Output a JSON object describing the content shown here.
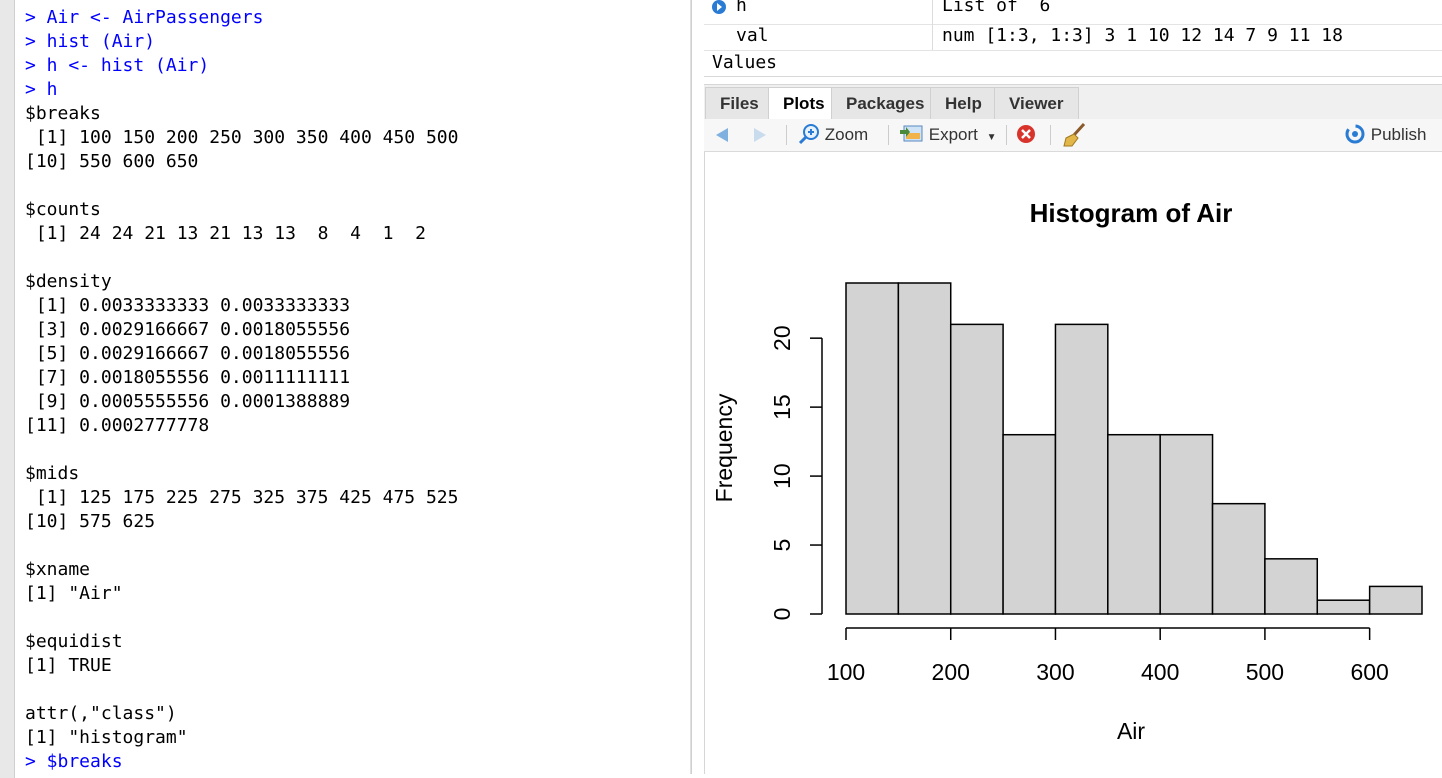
{
  "console": {
    "lines": [
      {
        "text": "> Air <- AirPassengers",
        "type": "cmd"
      },
      {
        "text": "> hist (Air)",
        "type": "cmd"
      },
      {
        "text": "> h <- hist (Air)",
        "type": "cmd"
      },
      {
        "text": "> h",
        "type": "cmd"
      },
      {
        "text": "$breaks",
        "type": "out"
      },
      {
        "text": " [1] 100 150 200 250 300 350 400 450 500",
        "type": "out"
      },
      {
        "text": "[10] 550 600 650",
        "type": "out"
      },
      {
        "text": "",
        "type": "out"
      },
      {
        "text": "$counts",
        "type": "out"
      },
      {
        "text": " [1] 24 24 21 13 21 13 13  8  4  1  2",
        "type": "out"
      },
      {
        "text": "",
        "type": "out"
      },
      {
        "text": "$density",
        "type": "out"
      },
      {
        "text": " [1] 0.0033333333 0.0033333333",
        "type": "out"
      },
      {
        "text": " [3] 0.0029166667 0.0018055556",
        "type": "out"
      },
      {
        "text": " [5] 0.0029166667 0.0018055556",
        "type": "out"
      },
      {
        "text": " [7] 0.0018055556 0.0011111111",
        "type": "out"
      },
      {
        "text": " [9] 0.0005555556 0.0001388889",
        "type": "out"
      },
      {
        "text": "[11] 0.0002777778",
        "type": "out"
      },
      {
        "text": "",
        "type": "out"
      },
      {
        "text": "$mids",
        "type": "out"
      },
      {
        "text": " [1] 125 175 225 275 325 375 425 475 525",
        "type": "out"
      },
      {
        "text": "[10] 575 625",
        "type": "out"
      },
      {
        "text": "",
        "type": "out"
      },
      {
        "text": "$xname",
        "type": "out"
      },
      {
        "text": "[1] \"Air\"",
        "type": "out"
      },
      {
        "text": "",
        "type": "out"
      },
      {
        "text": "$equidist",
        "type": "out"
      },
      {
        "text": "[1] TRUE",
        "type": "out"
      },
      {
        "text": "",
        "type": "out"
      },
      {
        "text": "attr(,\"class\")",
        "type": "out"
      },
      {
        "text": "[1] \"histogram\"",
        "type": "out"
      },
      {
        "text": "> $breaks",
        "type": "cmd"
      }
    ]
  },
  "environment": {
    "rows": [
      {
        "name": "h",
        "value": "List of  6"
      },
      {
        "name": "val",
        "value": "num [1:3, 1:3] 3 1 10 12 14 7 9 11 18"
      }
    ],
    "section": "Values"
  },
  "tabs": [
    {
      "label": "Files",
      "active": false
    },
    {
      "label": "Plots",
      "active": true
    },
    {
      "label": "Packages",
      "active": false
    },
    {
      "label": "Help",
      "active": false
    },
    {
      "label": "Viewer",
      "active": false
    }
  ],
  "toolbar": {
    "zoom_label": "Zoom",
    "export_label": "Export",
    "publish_label": "Publish",
    "icons": [
      "back-arrow-icon",
      "forward-arrow-icon",
      "zoom-icon",
      "export-icon",
      "remove-plot-icon",
      "broom-icon",
      "publish-icon"
    ]
  },
  "colors": {
    "command_text": "#0000ff",
    "bar_fill": "#d3d3d3",
    "bar_stroke": "#000000"
  },
  "chart_data": {
    "type": "bar",
    "title": "Histogram of Air",
    "xlabel": "Air",
    "ylabel": "Frequency",
    "breaks": [
      100,
      150,
      200,
      250,
      300,
      350,
      400,
      450,
      500,
      550,
      600,
      650
    ],
    "values": [
      24,
      24,
      21,
      13,
      21,
      13,
      13,
      8,
      4,
      1,
      2
    ],
    "xticks": [
      100,
      200,
      300,
      400,
      500,
      600
    ],
    "yticks": [
      0,
      5,
      10,
      15,
      20
    ],
    "xlim": [
      100,
      650
    ],
    "ylim": [
      0,
      24
    ],
    "grid": false
  }
}
